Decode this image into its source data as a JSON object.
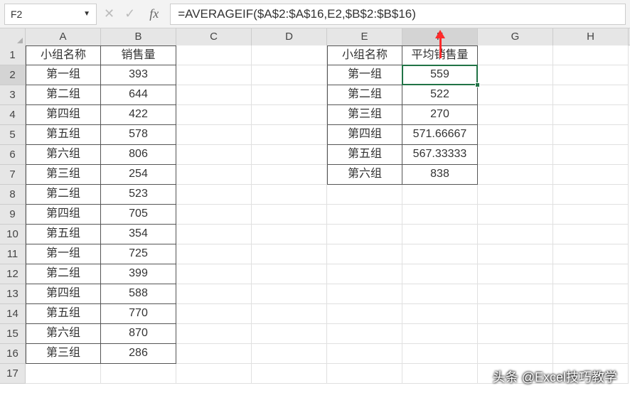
{
  "nameBox": "F2",
  "formula": "=AVERAGEIF($A$2:$A$16,E2,$B$2:$B$16)",
  "columns": [
    "A",
    "B",
    "C",
    "D",
    "E",
    "F",
    "G",
    "H"
  ],
  "selectedCol": "F",
  "selectedRow": 2,
  "rowCount": 17,
  "headersAB": {
    "A": "小组名称",
    "B": "销售量"
  },
  "headersEF": {
    "E": "小组名称",
    "F": "平均销售量"
  },
  "dataAB": [
    {
      "A": "第一组",
      "B": "393"
    },
    {
      "A": "第二组",
      "B": "644"
    },
    {
      "A": "第四组",
      "B": "422"
    },
    {
      "A": "第五组",
      "B": "578"
    },
    {
      "A": "第六组",
      "B": "806"
    },
    {
      "A": "第三组",
      "B": "254"
    },
    {
      "A": "第二组",
      "B": "523"
    },
    {
      "A": "第四组",
      "B": "705"
    },
    {
      "A": "第五组",
      "B": "354"
    },
    {
      "A": "第一组",
      "B": "725"
    },
    {
      "A": "第二组",
      "B": "399"
    },
    {
      "A": "第四组",
      "B": "588"
    },
    {
      "A": "第五组",
      "B": "770"
    },
    {
      "A": "第六组",
      "B": "870"
    },
    {
      "A": "第三组",
      "B": "286"
    }
  ],
  "dataEF": [
    {
      "E": "第一组",
      "F": "559"
    },
    {
      "E": "第二组",
      "F": "522"
    },
    {
      "E": "第三组",
      "F": "270"
    },
    {
      "E": "第四组",
      "F": "571.66667"
    },
    {
      "E": "第五组",
      "F": "567.33333"
    },
    {
      "E": "第六组",
      "F": "838"
    }
  ],
  "watermark": "头条 @Excel技巧教学"
}
